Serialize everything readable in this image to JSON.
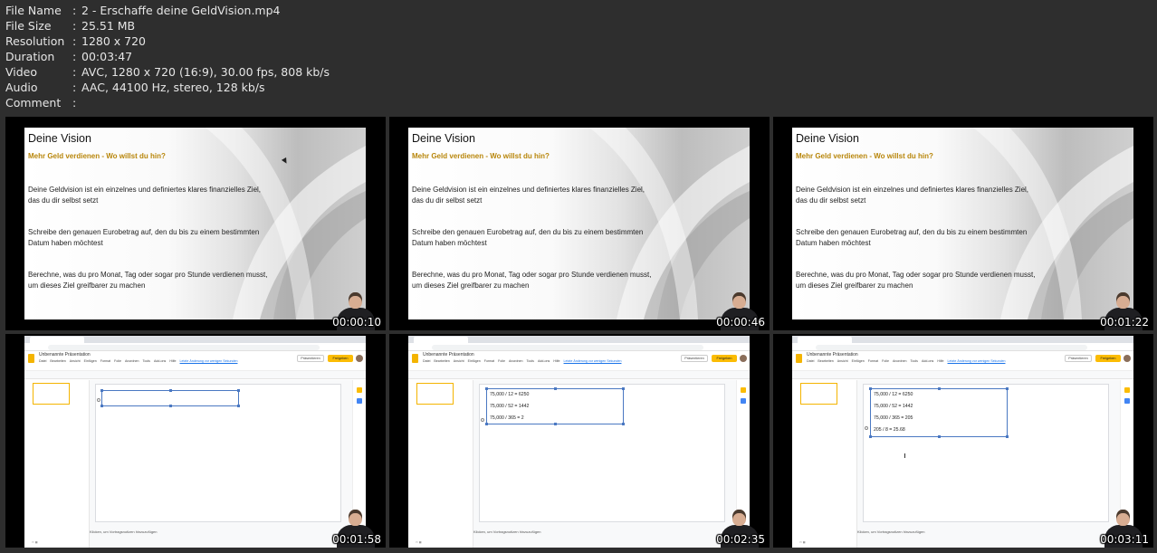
{
  "file_info": [
    {
      "key": "File Name",
      "value": "2 - Erschaffe deine GeldVision.mp4"
    },
    {
      "key": "File Size",
      "value": "25.51 MB"
    },
    {
      "key": "Resolution",
      "value": "1280 x 720"
    },
    {
      "key": "Duration",
      "value": "00:03:47"
    },
    {
      "key": "Video",
      "value": "AVC, 1280 x 720 (16:9), 30.00 fps, 808 kb/s"
    },
    {
      "key": "Audio",
      "value": "AAC, 44100 Hz, stereo, 128 kb/s"
    },
    {
      "key": "Comment",
      "value": ""
    }
  ],
  "separator": ":",
  "slide": {
    "title": "Deine Vision",
    "subtitle": "Mehr Geld verdienen - Wo willst du hin?",
    "paragraphs": [
      "Deine Geldvision ist ein einzelnes und definiertes klares finanzielles Ziel, das du dir selbst setzt",
      "Schreibe den genauen Eurobetrag auf, den du bis zu einem bestimmten Datum haben möchtest",
      "Berechne, was du pro Monat, Tag oder sogar pro Stunde verdienen musst, um dieses Ziel greifbarer zu machen"
    ]
  },
  "timestamps": [
    "00:00:10",
    "00:00:46",
    "00:01:22",
    "00:01:58",
    "00:02:35",
    "00:03:11"
  ],
  "editor": {
    "doc_title": "Unbenannte Präsentation",
    "menu": [
      "Datei",
      "Bearbeiten",
      "Ansicht",
      "Einfügen",
      "Format",
      "Folie",
      "Anordnen",
      "Tools",
      "Add-ons",
      "Hilfe"
    ],
    "saved_hint": "Letzte Änderung vor wenigen Sekunden",
    "present_label": "Präsentieren",
    "share_label": "Freigeben",
    "notes_placeholder": "Klicken, um Vortragsnotizen hinzuzufügen"
  },
  "calculations": {
    "frame5": [
      "75,000 / 12 = 6250",
      "75,000 / 52 = 1442",
      "75,000 / 365 = 2"
    ],
    "frame6": [
      "75,000 / 12 = 6250",
      "75,000 / 52 = 1442",
      "75,000 / 365 = 205",
      "205 / 8 = 25.68"
    ]
  },
  "colors": {
    "background": "#2e2e2e",
    "subtitle": "#b8860b",
    "selection": "#4a78c2",
    "share": "#fbbc04"
  }
}
